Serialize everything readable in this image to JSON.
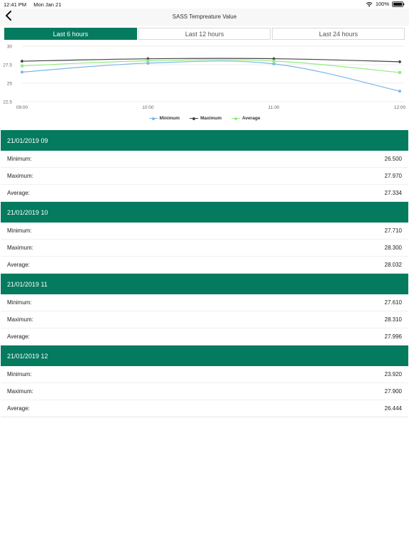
{
  "status_bar": {
    "time": "12:41 PM",
    "date": "Mon Jan 21",
    "battery": "100%"
  },
  "nav": {
    "title": "SASS Tempreature Value"
  },
  "tabs": [
    {
      "label": "Last 6 hours",
      "active": true
    },
    {
      "label": "Last 12 hours",
      "active": false
    },
    {
      "label": "Last 24 hours",
      "active": false
    }
  ],
  "chart_data": {
    "type": "line",
    "x": [
      "09:00",
      "10:00",
      "11:00",
      "12:00"
    ],
    "ylim": [
      22.5,
      30
    ],
    "yticks": [
      "30",
      "27.5",
      "25",
      "22.5"
    ],
    "grid": true,
    "legend_position": "bottom",
    "series": [
      {
        "name": "Minimum",
        "color": "#7cb5ec",
        "values": [
          26.5,
          27.71,
          27.61,
          23.92
        ]
      },
      {
        "name": "Maximum",
        "color": "#434348",
        "values": [
          27.97,
          28.3,
          28.31,
          27.9
        ]
      },
      {
        "name": "Average",
        "color": "#90ed7d",
        "values": [
          27.334,
          28.032,
          27.996,
          26.444
        ]
      }
    ]
  },
  "labels": {
    "minimum": "Minimum:",
    "maximum": "Maximum:",
    "average": "Average:"
  },
  "records": [
    {
      "header": "21/01/2019 09",
      "minimum": "26.500",
      "maximum": "27.970",
      "average": "27.334"
    },
    {
      "header": "21/01/2019 10",
      "minimum": "27.710",
      "maximum": "28.300",
      "average": "28.032"
    },
    {
      "header": "21/01/2019 11",
      "minimum": "27.610",
      "maximum": "28.310",
      "average": "27.996"
    },
    {
      "header": "21/01/2019 12",
      "minimum": "23.920",
      "maximum": "27.900",
      "average": "26.444"
    }
  ]
}
